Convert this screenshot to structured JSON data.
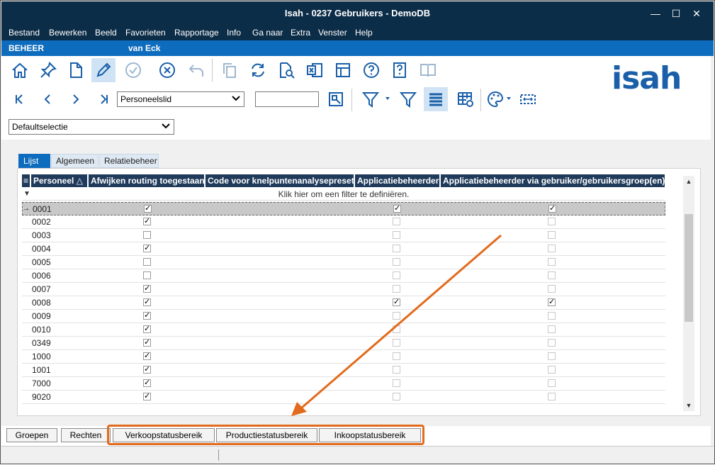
{
  "window": {
    "title": "Isah - 0237 Gebruikers - DemoDB",
    "minimize": "—",
    "maximize": "☐",
    "close": "✕"
  },
  "menu": [
    "Bestand",
    "Bewerken",
    "Beeld",
    "Favorieten",
    "Rapportage",
    "Info",
    "Ga naar",
    "Extra",
    "Venster",
    "Help"
  ],
  "strip": {
    "module": "BEHEER",
    "user": "van Eck"
  },
  "navigation": {
    "record_type": "Personeelslid",
    "search_value": "",
    "selection": "Defaultselectie"
  },
  "logo_text": "isah",
  "tabs": [
    {
      "label": "Lijst",
      "active": true
    },
    {
      "label": "Algemeen",
      "active": false
    },
    {
      "label": "Relatiebeheer",
      "active": false
    }
  ],
  "grid": {
    "columns": [
      "Personeel  △",
      "Afwijken routing toegestaan",
      "Code voor knelpuntenanalysepresets",
      "Applicatiebeheerder",
      "Applicatiebeheerder via gebruiker/gebruikersgroep(en)"
    ],
    "filter_hint": "Klik hier om een filter te definiëren.",
    "rows": [
      {
        "id": "0001",
        "routing": true,
        "admin": true,
        "admin_group": true,
        "selected": true
      },
      {
        "id": "0002",
        "routing": true,
        "admin": false,
        "admin_group": false,
        "selected": false
      },
      {
        "id": "0003",
        "routing": false,
        "admin": false,
        "admin_group": false,
        "selected": false
      },
      {
        "id": "0004",
        "routing": true,
        "admin": false,
        "admin_group": false,
        "selected": false
      },
      {
        "id": "0005",
        "routing": false,
        "admin": false,
        "admin_group": false,
        "selected": false
      },
      {
        "id": "0006",
        "routing": false,
        "admin": false,
        "admin_group": false,
        "selected": false
      },
      {
        "id": "0007",
        "routing": true,
        "admin": false,
        "admin_group": false,
        "selected": false
      },
      {
        "id": "0008",
        "routing": true,
        "admin": true,
        "admin_group": true,
        "selected": false
      },
      {
        "id": "0009",
        "routing": true,
        "admin": false,
        "admin_group": false,
        "selected": false
      },
      {
        "id": "0010",
        "routing": true,
        "admin": false,
        "admin_group": false,
        "selected": false
      },
      {
        "id": "0349",
        "routing": true,
        "admin": false,
        "admin_group": false,
        "selected": false
      },
      {
        "id": "1000",
        "routing": true,
        "admin": false,
        "admin_group": false,
        "selected": false
      },
      {
        "id": "1001",
        "routing": true,
        "admin": false,
        "admin_group": false,
        "selected": false
      },
      {
        "id": "7000",
        "routing": true,
        "admin": false,
        "admin_group": false,
        "selected": false
      },
      {
        "id": "9020",
        "routing": true,
        "admin": false,
        "admin_group": false,
        "selected": false
      }
    ]
  },
  "bottom_tabs": [
    "Groepen",
    "Rechten",
    "Verkoopstatusbereik",
    "Productiestatusbereik",
    "Inkoopstatusbereik"
  ],
  "colors": {
    "titlebar": "#0c2d48",
    "strip": "#0d6cbd",
    "header": "#1f3a5a",
    "highlight": "#e26b1e",
    "logo": "#1a5fa8"
  },
  "toolbar_icons": [
    "home-icon",
    "pin-icon",
    "new-document-icon",
    "edit-icon",
    "confirm-icon",
    "cancel-icon",
    "undo-icon",
    "copy-icon",
    "refresh-icon",
    "search-document-icon",
    "excel-icon",
    "layout-icon",
    "help-icon",
    "context-help-icon",
    "book-icon"
  ]
}
